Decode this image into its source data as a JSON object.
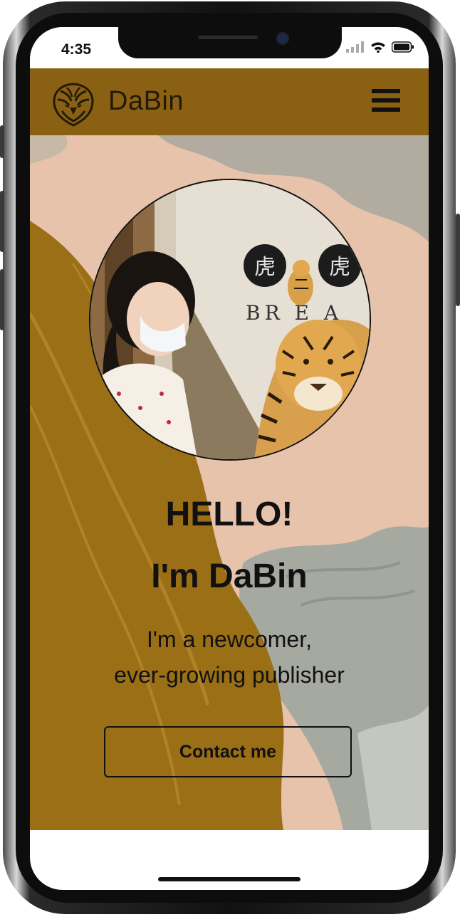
{
  "status_bar": {
    "time": "4:35"
  },
  "navbar": {
    "brand": "DaBin",
    "logo_icon": "tiger-head-icon",
    "menu_icon": "hamburger-menu-icon"
  },
  "hero": {
    "greeting": "HELLO!",
    "name_line": "I'm DaBin",
    "tagline_line1": "I'm a newcomer,",
    "tagline_line2": "ever-growing publisher",
    "contact_label": "Contact me",
    "photo_sign_text": "BR E A"
  },
  "colors": {
    "navbar": "#8a6113",
    "hero_peach": "#e7c3ab",
    "hero_mustard": "#9a6f16",
    "hero_gray": "#b1ac9f",
    "text": "#111111"
  }
}
